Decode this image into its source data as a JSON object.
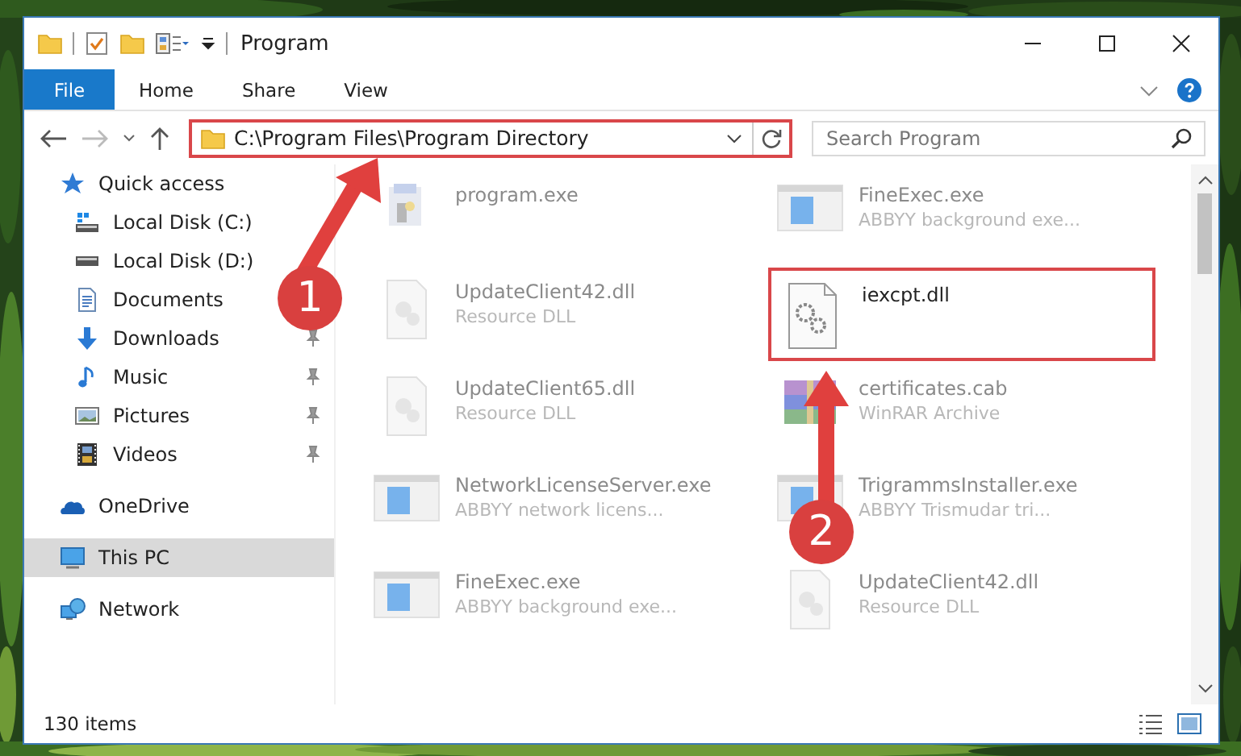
{
  "window": {
    "title": "Program"
  },
  "ribbon": {
    "tabs": [
      {
        "label": "File",
        "kind": "file"
      },
      {
        "label": "Home",
        "kind": "tab"
      },
      {
        "label": "Share",
        "kind": "tab"
      },
      {
        "label": "View",
        "kind": "tab"
      }
    ]
  },
  "address": {
    "path": "C:\\Program Files\\Program Directory",
    "highlighted": true
  },
  "search": {
    "placeholder": "Search Program"
  },
  "sidebar": {
    "items": [
      {
        "label": "Quick access",
        "kind": "quick",
        "selected": false,
        "pinned": false,
        "children": [
          {
            "label": "Local Disk (C:)",
            "kind": "sysdrive",
            "selected": false,
            "pinned": false
          },
          {
            "label": "Local Disk (D:)",
            "kind": "drive",
            "selected": false,
            "pinned": false
          },
          {
            "label": "Documents",
            "kind": "documents",
            "selected": false,
            "pinned": false
          },
          {
            "label": "Downloads",
            "kind": "downloads",
            "selected": false,
            "pinned": true
          },
          {
            "label": "Music",
            "kind": "music",
            "selected": false,
            "pinned": true
          },
          {
            "label": "Pictures",
            "kind": "pictures",
            "selected": false,
            "pinned": true
          },
          {
            "label": "Videos",
            "kind": "videos",
            "selected": false,
            "pinned": true
          }
        ]
      },
      {
        "label": "OneDrive",
        "kind": "onedrive",
        "selected": false,
        "pinned": false
      },
      {
        "label": "This PC",
        "kind": "pc",
        "selected": true,
        "pinned": false
      },
      {
        "label": "Network",
        "kind": "network",
        "selected": false,
        "pinned": false
      }
    ]
  },
  "files": [
    {
      "name": "program.exe",
      "kind": "setup",
      "faded": true
    },
    {
      "name": "UpdateClient42.dll",
      "type": "Resource DLL",
      "kind": "dll",
      "faded": true
    },
    {
      "name": "UpdateClient65.dll",
      "type": "Resource DLL",
      "kind": "dll",
      "faded": true
    },
    {
      "name": "NetworkLicenseServer.exe",
      "type": "ABBYY network licens...",
      "kind": "exe",
      "faded": true
    },
    {
      "name": "FineExec.exe",
      "type": "ABBYY background exe...",
      "kind": "exe",
      "faded": true
    },
    {
      "name": "FineExec.exe",
      "type": "ABBYY background exe...",
      "kind": "exe",
      "faded": true
    },
    {
      "name": "iexcpt.dll",
      "kind": "gear",
      "faded": false,
      "highlighted": true
    },
    {
      "name": "certificates.cab",
      "type": "WinRAR Archive",
      "kind": "archive",
      "faded": true
    },
    {
      "name": "TrigrammsInstaller.exe",
      "type": "ABBYY Trismudar tri...",
      "kind": "exe",
      "faded": true
    },
    {
      "name": "UpdateClient42.dll",
      "type": "Resource DLL",
      "kind": "dll",
      "faded": true
    }
  ],
  "status_bar": {
    "count": "130 items"
  },
  "annotations": [
    {
      "number": "1"
    },
    {
      "number": "2"
    }
  ]
}
